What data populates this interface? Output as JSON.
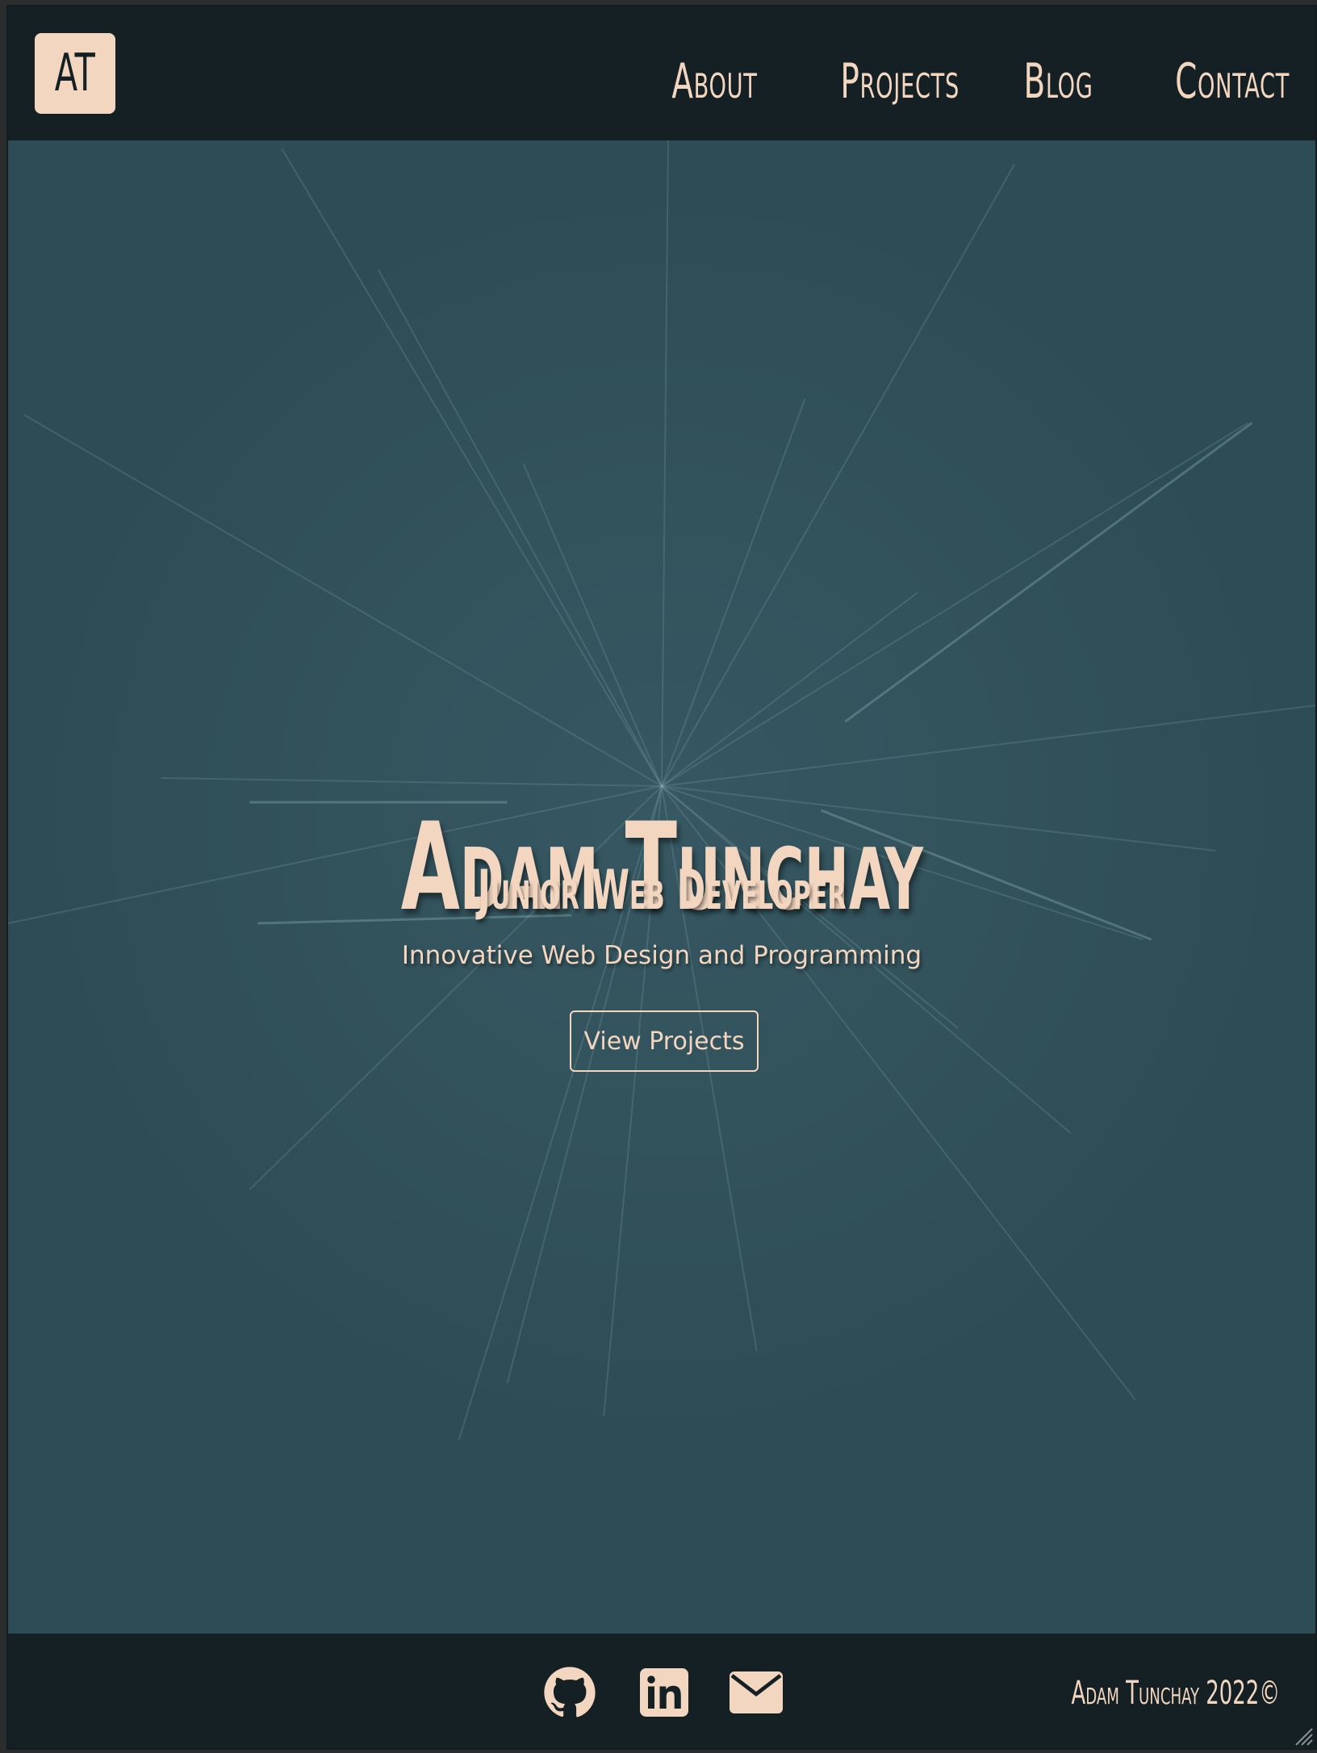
{
  "header": {
    "logo_text": "AT",
    "nav": [
      {
        "label": "About"
      },
      {
        "label": "Projects"
      },
      {
        "label": "Blog"
      },
      {
        "label": "Contact"
      }
    ]
  },
  "hero": {
    "name": "Adam Tunchay",
    "role": "Junior Web Developer",
    "tagline": "Innovative Web Design and Programming",
    "cta_label": "View Projects"
  },
  "footer": {
    "social_icons": [
      "github-icon",
      "linkedin-icon",
      "envelope-icon"
    ],
    "copyright": "Adam Tunchay 2022©"
  },
  "colors": {
    "accent": "#f3d6c0",
    "header_bg": "#152024",
    "hero_bg": "#2e4c56"
  }
}
